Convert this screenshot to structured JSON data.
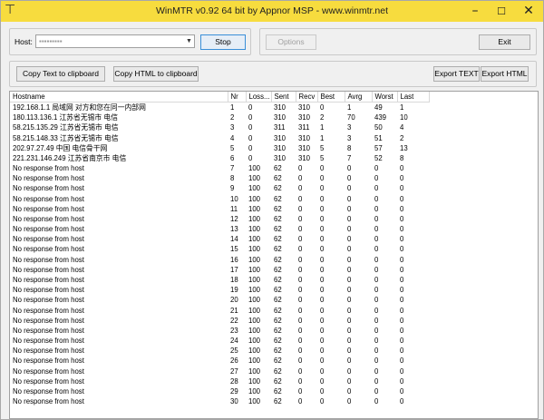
{
  "window": {
    "title": "WinMTR v0.92 64 bit by Appnor MSP - www.winmtr.net"
  },
  "host": {
    "label": "Host:"
  },
  "buttons": {
    "stop": "Stop",
    "options": "Options",
    "exit": "Exit",
    "copy_text": "Copy Text to clipboard",
    "copy_html": "Copy HTML to clipboard",
    "export_text": "Export TEXT",
    "export_html": "Export HTML"
  },
  "table": {
    "columns": [
      "Hostname",
      "Nr",
      "Loss...",
      "Sent",
      "Recv",
      "Best",
      "Avrg",
      "Worst",
      "Last"
    ],
    "rows": [
      [
        "192.168.1.1 局域网 对方和您在同一内部网",
        "1",
        "0",
        "310",
        "310",
        "0",
        "1",
        "49",
        "1"
      ],
      [
        "180.113.136.1 江苏省无锡市 电信",
        "2",
        "0",
        "310",
        "310",
        "2",
        "70",
        "439",
        "10"
      ],
      [
        "58.215.135.29 江苏省无锡市 电信",
        "3",
        "0",
        "311",
        "311",
        "1",
        "3",
        "50",
        "4"
      ],
      [
        "58.215.148.33 江苏省无锡市 电信",
        "4",
        "0",
        "310",
        "310",
        "1",
        "3",
        "51",
        "2"
      ],
      [
        "202.97.27.49 中国 电信骨干网",
        "5",
        "0",
        "310",
        "310",
        "5",
        "8",
        "57",
        "13"
      ],
      [
        "221.231.146.249 江苏省南京市 电信",
        "6",
        "0",
        "310",
        "310",
        "5",
        "7",
        "52",
        "8"
      ],
      [
        "No response from host",
        "7",
        "100",
        "62",
        "0",
        "0",
        "0",
        "0",
        "0"
      ],
      [
        "No response from host",
        "8",
        "100",
        "62",
        "0",
        "0",
        "0",
        "0",
        "0"
      ],
      [
        "No response from host",
        "9",
        "100",
        "62",
        "0",
        "0",
        "0",
        "0",
        "0"
      ],
      [
        "No response from host",
        "10",
        "100",
        "62",
        "0",
        "0",
        "0",
        "0",
        "0"
      ],
      [
        "No response from host",
        "11",
        "100",
        "62",
        "0",
        "0",
        "0",
        "0",
        "0"
      ],
      [
        "No response from host",
        "12",
        "100",
        "62",
        "0",
        "0",
        "0",
        "0",
        "0"
      ],
      [
        "No response from host",
        "13",
        "100",
        "62",
        "0",
        "0",
        "0",
        "0",
        "0"
      ],
      [
        "No response from host",
        "14",
        "100",
        "62",
        "0",
        "0",
        "0",
        "0",
        "0"
      ],
      [
        "No response from host",
        "15",
        "100",
        "62",
        "0",
        "0",
        "0",
        "0",
        "0"
      ],
      [
        "No response from host",
        "16",
        "100",
        "62",
        "0",
        "0",
        "0",
        "0",
        "0"
      ],
      [
        "No response from host",
        "17",
        "100",
        "62",
        "0",
        "0",
        "0",
        "0",
        "0"
      ],
      [
        "No response from host",
        "18",
        "100",
        "62",
        "0",
        "0",
        "0",
        "0",
        "0"
      ],
      [
        "No response from host",
        "19",
        "100",
        "62",
        "0",
        "0",
        "0",
        "0",
        "0"
      ],
      [
        "No response from host",
        "20",
        "100",
        "62",
        "0",
        "0",
        "0",
        "0",
        "0"
      ],
      [
        "No response from host",
        "21",
        "100",
        "62",
        "0",
        "0",
        "0",
        "0",
        "0"
      ],
      [
        "No response from host",
        "22",
        "100",
        "62",
        "0",
        "0",
        "0",
        "0",
        "0"
      ],
      [
        "No response from host",
        "23",
        "100",
        "62",
        "0",
        "0",
        "0",
        "0",
        "0"
      ],
      [
        "No response from host",
        "24",
        "100",
        "62",
        "0",
        "0",
        "0",
        "0",
        "0"
      ],
      [
        "No response from host",
        "25",
        "100",
        "62",
        "0",
        "0",
        "0",
        "0",
        "0"
      ],
      [
        "No response from host",
        "26",
        "100",
        "62",
        "0",
        "0",
        "0",
        "0",
        "0"
      ],
      [
        "No response from host",
        "27",
        "100",
        "62",
        "0",
        "0",
        "0",
        "0",
        "0"
      ],
      [
        "No response from host",
        "28",
        "100",
        "62",
        "0",
        "0",
        "0",
        "0",
        "0"
      ],
      [
        "No response from host",
        "29",
        "100",
        "62",
        "0",
        "0",
        "0",
        "0",
        "0"
      ],
      [
        "No response from host",
        "30",
        "100",
        "62",
        "0",
        "0",
        "0",
        "0",
        "0"
      ]
    ]
  },
  "colors": {
    "titlebar": "#f7dc3e",
    "window_bg": "#f0f0f0"
  }
}
